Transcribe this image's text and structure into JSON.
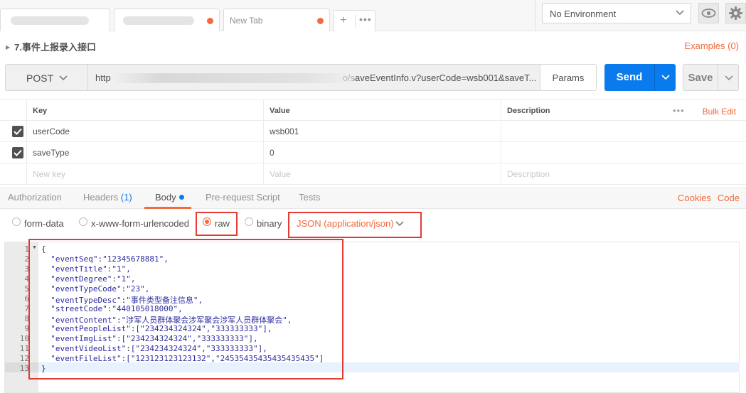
{
  "tabs": [
    {
      "label": "",
      "blurred": true
    },
    {
      "label": "",
      "blurred": true
    },
    {
      "label": "New Tab"
    }
  ],
  "tab_actions": {
    "add": "+",
    "more": "•••"
  },
  "environment": {
    "selected": "No Environment"
  },
  "request": {
    "name": "7.事件上报录入接口",
    "examples": "Examples (0)",
    "method": "POST",
    "url_visible_start": "http",
    "url_visible_end": "o/saveEventInfo.v?userCode=wsb001&saveT...",
    "params_label": "Params",
    "send_label": "Send",
    "save_label": "Save"
  },
  "params_table": {
    "headers": {
      "key": "Key",
      "value": "Value",
      "description": "Description"
    },
    "bulk_edit": "Bulk Edit",
    "rows": [
      {
        "key": "userCode",
        "value": "wsb001",
        "checked": true
      },
      {
        "key": "saveType",
        "value": "0",
        "checked": true
      }
    ],
    "placeholders": {
      "key": "New key",
      "value": "Value",
      "description": "Description"
    }
  },
  "subtabs": {
    "authorization": "Authorization",
    "headers": "Headers",
    "headers_count": "(1)",
    "body": "Body",
    "prerequest": "Pre-request Script",
    "tests": "Tests",
    "cookies": "Cookies",
    "code": "Code"
  },
  "body_modes": {
    "form_data": "form-data",
    "urlencoded": "x-www-form-urlencoded",
    "raw": "raw",
    "binary": "binary",
    "selected": "raw",
    "content_type": "JSON (application/json)"
  },
  "editor": {
    "line_numbers": [
      "1",
      "2",
      "3",
      "4",
      "5",
      "6",
      "7",
      "8",
      "9",
      "10",
      "11",
      "12",
      "13"
    ],
    "lines": [
      {
        "key": "",
        "value": "{"
      },
      {
        "key": "\"eventSeq\"",
        "value": "\"12345678881\","
      },
      {
        "key": "\"eventTitle\"",
        "value": "\"1\","
      },
      {
        "key": "\"eventDegree\"",
        "value": "\"1\","
      },
      {
        "key": "\"eventTypeCode\"",
        "value": "\"23\","
      },
      {
        "key": "\"eventTypeDesc\"",
        "value": "\"事件类型备注信息\","
      },
      {
        "key": "\"streetCode\"",
        "value": "\"440105018000\","
      },
      {
        "key": "\"eventContent\"",
        "value": "\"涉军人员群体聚会涉军聚会涉军人员群体聚会\","
      },
      {
        "key": "\"eventPeopleList\"",
        "value": "[\"234234324324\",\"333333333\"],"
      },
      {
        "key": "\"eventImgList\"",
        "value": "[\"234234324324\",\"333333333\"],"
      },
      {
        "key": "\"eventVideoList\"",
        "value": "[\"234234324324\",\"333333333\"],"
      },
      {
        "key": "\"eventFileList\"",
        "value": "[\"123123123123132\",\"24535435435435435435\"]"
      },
      {
        "key": "",
        "value": "}"
      }
    ]
  },
  "colors": {
    "accent": "#f26b3a",
    "send": "#097bed",
    "highlight_box": "#e53935"
  }
}
